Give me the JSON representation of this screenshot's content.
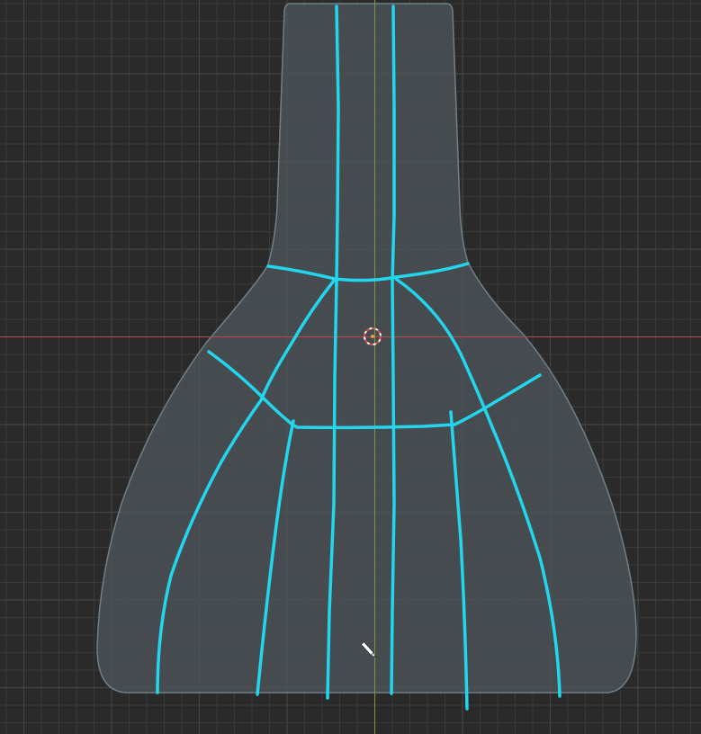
{
  "viewport": {
    "background": "#2a2a2a",
    "grid_minor_color": "#3a3a3a",
    "grid_major_color": "#444444",
    "x_axis_color": "#c0444d",
    "y_axis_color": "#7a9a3a"
  },
  "mesh": {
    "fill": "#4d5358",
    "outline": "#6f8088",
    "stroke_color": "#22d6ee"
  },
  "cursor": {
    "icon": "pencil-icon",
    "color": "#ffffff"
  },
  "origin": {
    "icon": "3d-cursor-icon",
    "ring_color_a": "#e05050",
    "ring_color_b": "#ffffff"
  }
}
